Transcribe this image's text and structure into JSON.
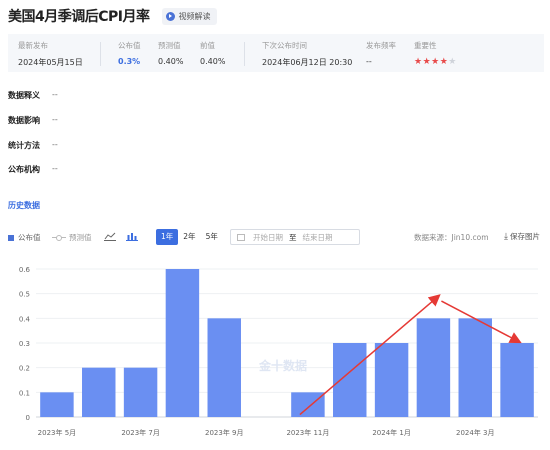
{
  "header": {
    "title": "美国4月季调后CPI月率",
    "video_button": "视频解读"
  },
  "info": {
    "latest_label": "最新发布",
    "latest_value": "2024年05月15日",
    "published_label": "公布值",
    "published_value": "0.3%",
    "forecast_label": "预测值",
    "forecast_value": "0.40%",
    "previous_label": "前值",
    "previous_value": "0.40%",
    "next_label": "下次公布时间",
    "next_value": "2024年06月12日 20:30",
    "freq_label": "发布频率",
    "freq_value": "--",
    "importance_label": "重要性",
    "importance_stars": 4,
    "importance_max": 5
  },
  "details": [
    {
      "key": "数据释义",
      "value": "--"
    },
    {
      "key": "数据影响",
      "value": "--"
    },
    {
      "key": "统计方法",
      "value": "--"
    },
    {
      "key": "公布机构",
      "value": "--"
    }
  ],
  "history_link": "历史数据",
  "toolbar": {
    "legend_published": "公布值",
    "legend_forecast": "预测值",
    "line_icon": "line-chart-icon",
    "bar_icon": "bar-chart-icon",
    "ranges": [
      "1年",
      "2年",
      "5年"
    ],
    "active_range": "1年",
    "start_placeholder": "开始日期",
    "separator": "至",
    "end_placeholder": "结束日期",
    "source": "数据来源：Jin10.com",
    "save": "保存图片"
  },
  "colors": {
    "bar": "#6a8ff2",
    "accent": "#3c6ee0",
    "annotation": "#e53935",
    "star": "#e84a4a"
  },
  "chart_data": {
    "type": "bar",
    "categories": [
      "2023年 5月",
      "2023年 6月",
      "2023年 7月",
      "2023年 8月",
      "2023年 9月",
      "2023年 10月",
      "2023年 11月",
      "2023年 12月",
      "2024年 1月",
      "2024年 2月",
      "2024年 3月",
      "2024年 4月"
    ],
    "values": [
      0.1,
      0.2,
      0.2,
      0.6,
      0.4,
      0.0,
      0.1,
      0.3,
      0.3,
      0.4,
      0.4,
      0.3
    ],
    "x_tick_labels": [
      "2023年 5月",
      "2023年 7月",
      "2023年 9月",
      "2023年 11月",
      "2024年 1月",
      "2024年 3月"
    ],
    "y_ticks": [
      0,
      0.1,
      0.2,
      0.3,
      0.4,
      0.5,
      0.6
    ],
    "ylim": [
      0,
      0.6
    ],
    "grid": "horizontal",
    "watermark": "金十数据",
    "annotations": "red arrows drawn over chart: rising from Nov 2023 to Feb 2024, falling from Feb 2024 to Apr 2024"
  }
}
